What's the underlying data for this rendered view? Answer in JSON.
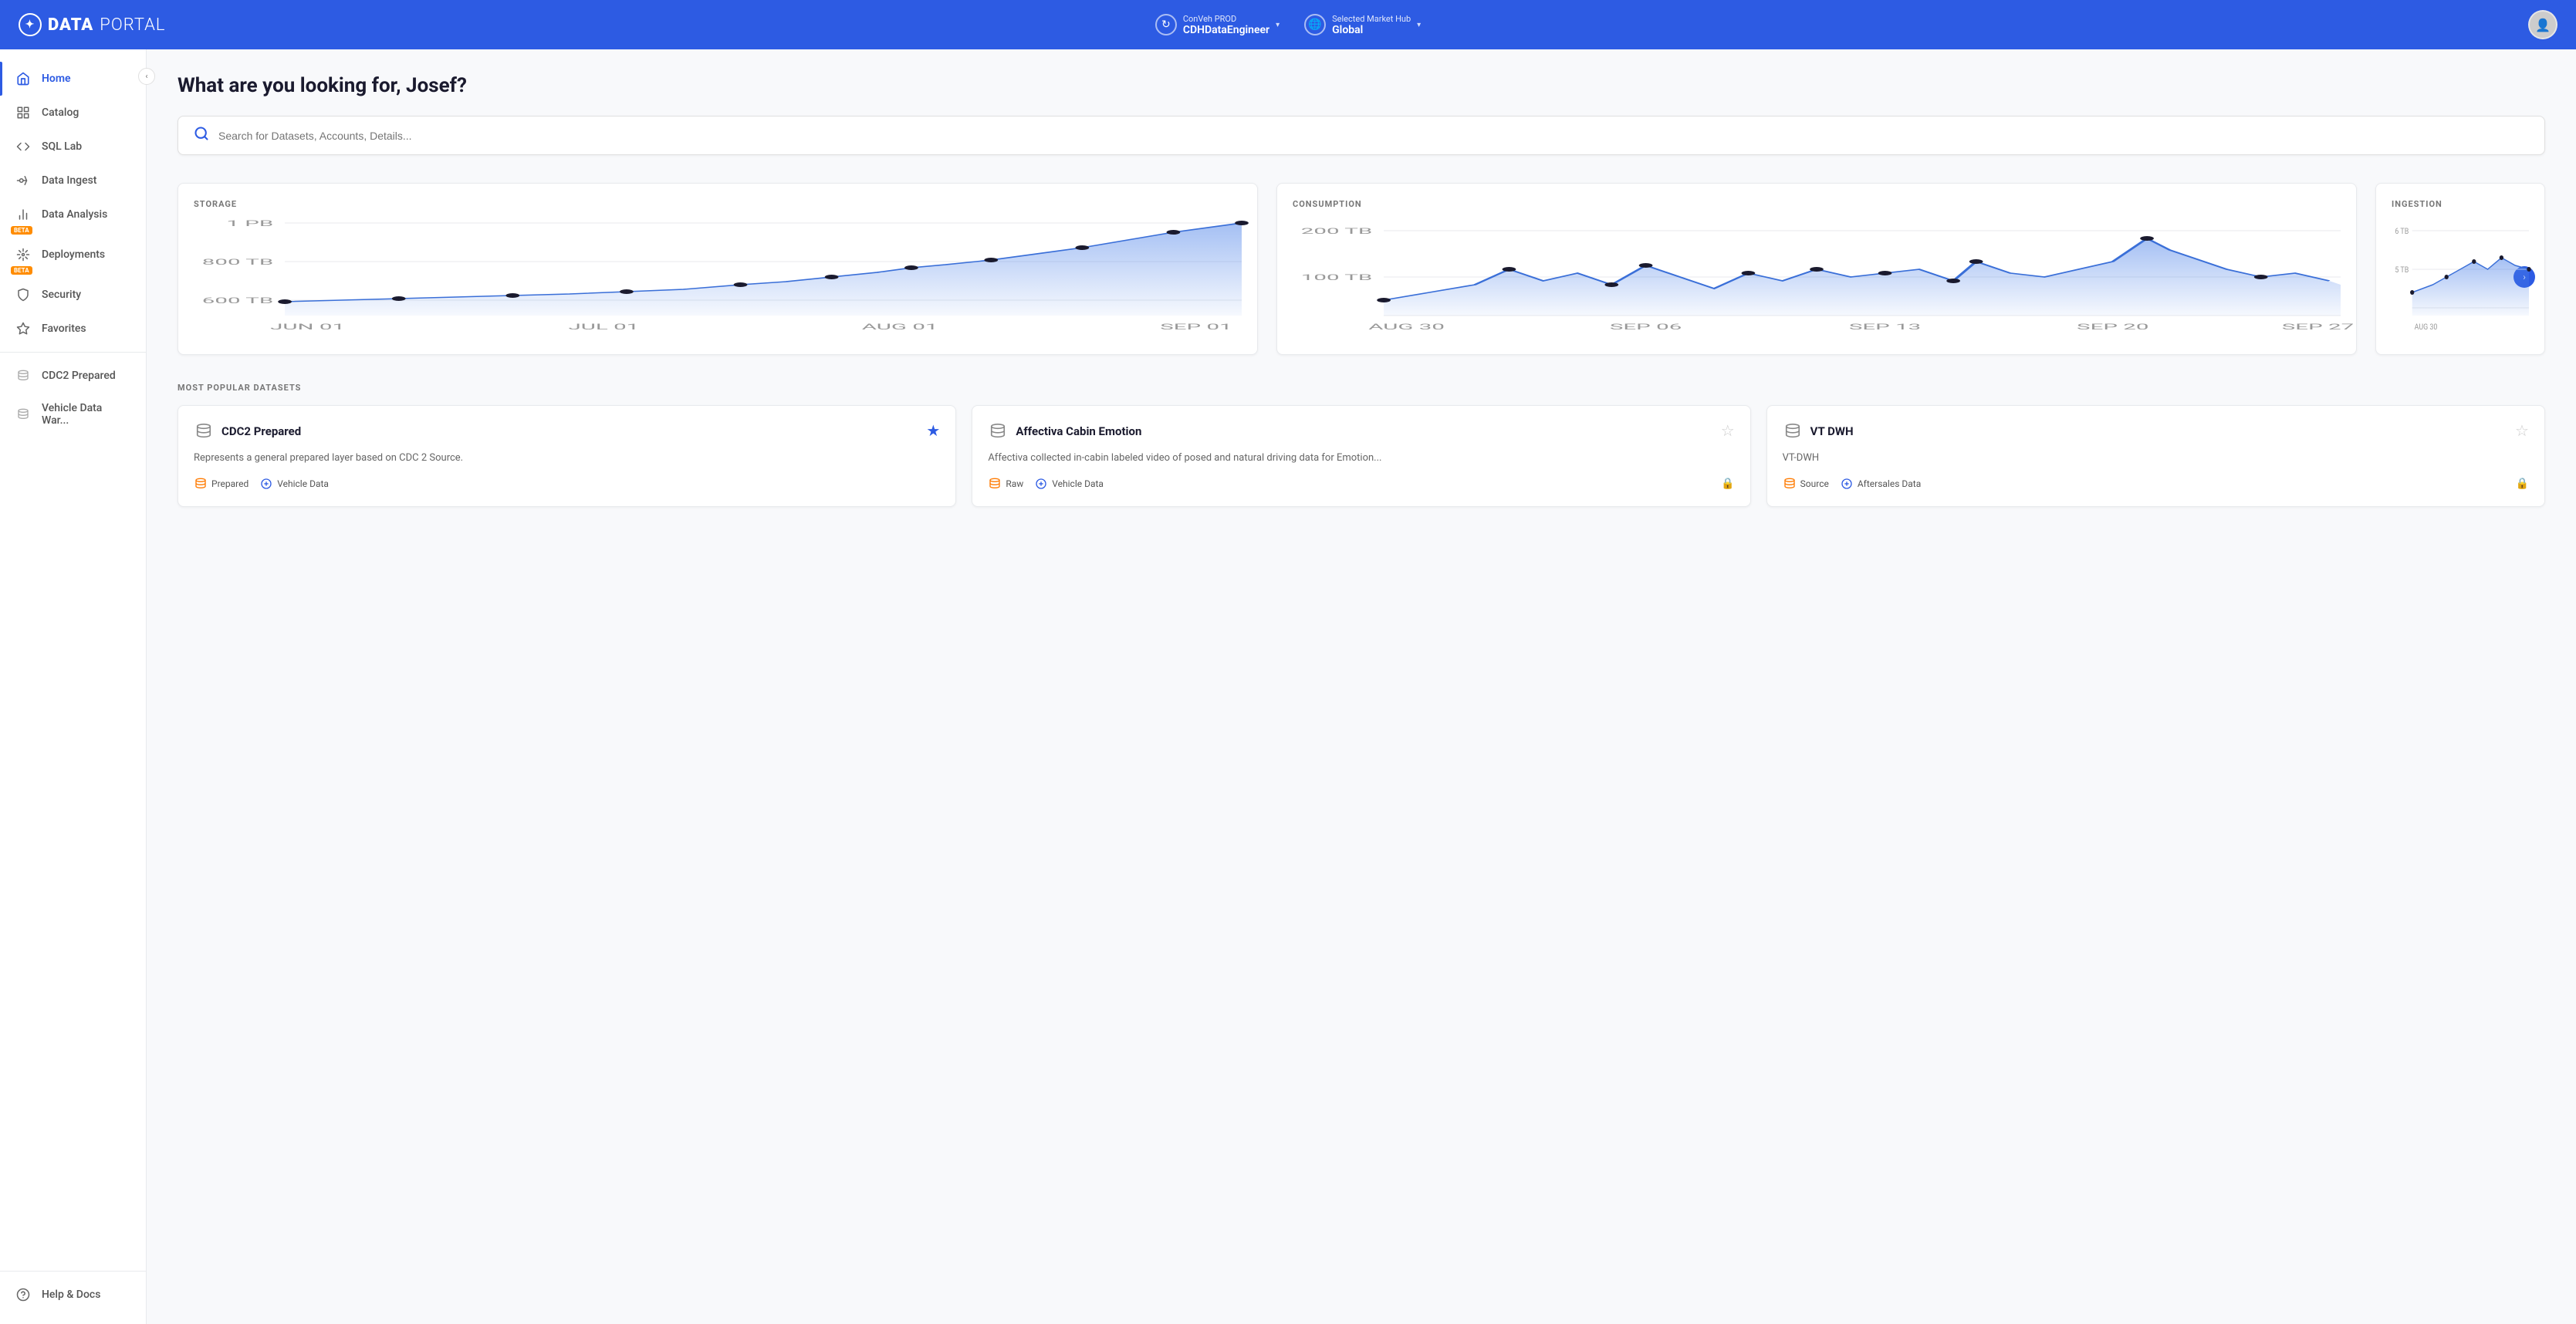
{
  "header": {
    "logo_bold": "DATA",
    "logo_light": "PORTAL",
    "env_label_small": "ConVeh PROD",
    "env_label_main": "CDHDataEngineer",
    "market_label_small": "Selected Market Hub",
    "market_label_main": "Global"
  },
  "sidebar": {
    "collapse_icon": "‹",
    "items": [
      {
        "id": "home",
        "label": "Home",
        "icon": "🏠",
        "active": true,
        "beta": false
      },
      {
        "id": "catalog",
        "label": "Catalog",
        "icon": "⊞",
        "active": false,
        "beta": false
      },
      {
        "id": "sql-lab",
        "label": "SQL Lab",
        "icon": "◈",
        "active": false,
        "beta": false
      },
      {
        "id": "data-ingest",
        "label": "Data Ingest",
        "icon": "→⊡",
        "active": false,
        "beta": false
      },
      {
        "id": "data-analysis",
        "label": "Data Analysis",
        "icon": "📊",
        "active": false,
        "beta": true
      },
      {
        "id": "deployments",
        "label": "Deployments",
        "icon": "⛓",
        "active": false,
        "beta": true
      },
      {
        "id": "security",
        "label": "Security",
        "icon": "🛡",
        "active": false,
        "beta": false
      },
      {
        "id": "favorites",
        "label": "Favorites",
        "icon": "☆",
        "active": false,
        "beta": false
      }
    ],
    "recent_items": [
      {
        "label": "CDC2 Prepared",
        "icon": "🗄"
      },
      {
        "label": "Vehicle Data War...",
        "icon": "🗄"
      }
    ],
    "bottom_items": [
      {
        "id": "help",
        "label": "Help & Docs",
        "icon": "ℹ"
      }
    ]
  },
  "main": {
    "greeting": "What are you looking for, Josef?",
    "search_placeholder": "Search for Datasets, Accounts, Details...",
    "charts": {
      "storage": {
        "title": "STORAGE",
        "y_labels": [
          "1 PB",
          "800 TB",
          "600 TB"
        ],
        "x_labels": [
          "JUN 01",
          "JUL 01",
          "AUG 01",
          "SEP 01"
        ],
        "data_points": [
          10,
          12,
          13,
          14,
          15,
          16,
          17,
          18,
          20,
          22,
          25,
          28,
          32,
          36,
          40,
          46,
          52,
          58,
          65,
          73,
          82,
          90
        ]
      },
      "consumption": {
        "title": "CONSUMPTION",
        "y_labels": [
          "200 TB",
          "100 TB"
        ],
        "x_labels": [
          "AUG 30",
          "SEP 06",
          "SEP 13",
          "SEP 20",
          "SEP 27"
        ],
        "data_points": [
          20,
          35,
          25,
          40,
          30,
          45,
          38,
          55,
          32,
          28,
          42,
          38,
          30,
          25,
          35,
          28,
          45,
          85,
          70,
          50,
          40,
          35
        ]
      },
      "ingestion": {
        "title": "INGESTION",
        "y_labels": [
          "6 TB",
          "5 TB"
        ],
        "x_labels": [
          "AUG 30"
        ],
        "data_points": [
          20,
          30,
          25,
          35,
          28,
          40,
          35,
          50,
          45
        ]
      }
    },
    "most_popular_datasets": {
      "section_title": "MOST POPULAR DATASETS",
      "items": [
        {
          "id": "cdc2",
          "name": "CDC2 Prepared",
          "description": "Represents a general prepared layer based on CDC 2 Source.",
          "starred": true,
          "tags": [
            {
              "label": "Prepared",
              "type": "orange"
            },
            {
              "label": "Vehicle Data",
              "type": "blue"
            }
          ],
          "locked": false
        },
        {
          "id": "affectiva",
          "name": "Affectiva Cabin Emotion",
          "description": "Affectiva collected in-cabin labeled video of posed and natural driving data for Emotion...",
          "starred": false,
          "tags": [
            {
              "label": "Raw",
              "type": "orange"
            },
            {
              "label": "Vehicle Data",
              "type": "blue"
            }
          ],
          "locked": true
        },
        {
          "id": "vt-dwh",
          "name": "VT DWH",
          "description": "VT-DWH",
          "starred": false,
          "tags": [
            {
              "label": "Source",
              "type": "orange"
            },
            {
              "label": "Aftersales Data",
              "type": "blue"
            }
          ],
          "locked": true
        }
      ]
    }
  },
  "icons": {
    "search": "🔍",
    "home": "⌂",
    "chevron_left": "‹",
    "chevron_right": "›",
    "star_filled": "★",
    "star_empty": "☆",
    "lock": "🔒",
    "globe": "🌐",
    "refresh": "↻",
    "database": "🗄",
    "shield": "🛡"
  },
  "colors": {
    "primary": "#2d5be3",
    "header_bg": "#2d5be3",
    "sidebar_bg": "#ffffff",
    "content_bg": "#f8f9fb",
    "chart_fill": "rgba(100,140,240,0.25)",
    "chart_stroke": "#3a6fd8",
    "orange": "#ff7a00",
    "text_dark": "#1a1a2e",
    "text_mid": "#555555",
    "text_light": "#777777"
  }
}
